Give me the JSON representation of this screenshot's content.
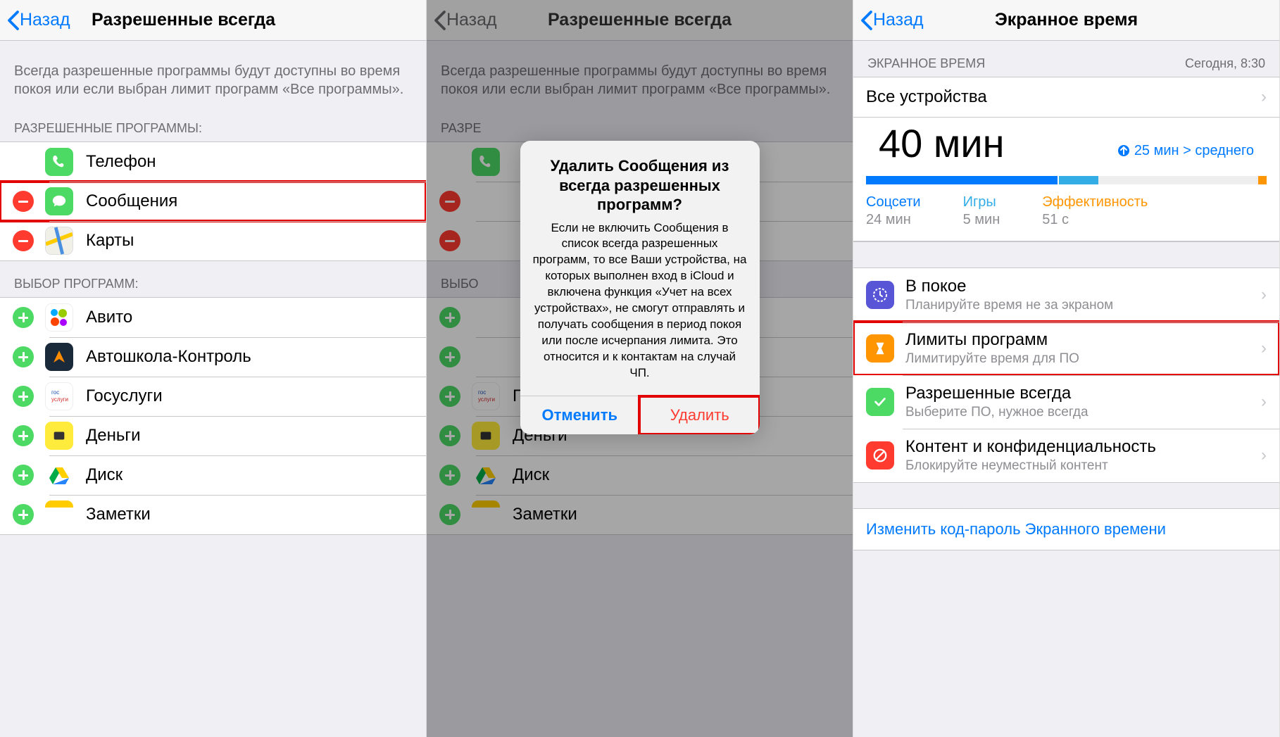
{
  "panel1": {
    "back": "Назад",
    "title": "Разрешенные всегда",
    "desc": "Всегда разрешенные программы будут доступны во время покоя или если выбран лимит программ «Все программы».",
    "sectionAllowed": "РАЗРЕШЕННЫЕ ПРОГРАММЫ:",
    "sectionChoose": "ВЫБОР ПРОГРАММ:",
    "allowed": [
      "Телефон",
      "Сообщения",
      "Карты"
    ],
    "choose": [
      "Авито",
      "Автошкола-Контроль",
      "Госуслуги",
      "Деньги",
      "Диск",
      "Заметки"
    ]
  },
  "panel2": {
    "back": "Назад",
    "title": "Разрешенные всегда",
    "desc": "Всегда разрешенные программы будут доступны во время покоя или если выбран лимит программ «Все программы».",
    "sectionAllowed": "РАЗРЕ",
    "sectionChoose": "ВЫБО",
    "allowed_row1": "",
    "choose": [
      "",
      "",
      "Госуслуги",
      "Деньги",
      "Диск",
      "Заметки"
    ],
    "dialog": {
      "title": "Удалить Сообщения из всегда разрешенных программ?",
      "body": "Если не включить Сообщения в список всегда разрешенных программ, то все Ваши устройства, на которых выполнен вход в iCloud и включена функция «Учет на всех устройствах», не смогут отправлять и получать сообщения в период покоя или после исчерпания лимита. Это относится и к контактам на случай ЧП.",
      "cancel": "Отменить",
      "delete": "Удалить"
    }
  },
  "panel3": {
    "back": "Назад",
    "title": "Экранное время",
    "sectionTime": "ЭКРАННОЕ ВРЕМЯ",
    "sectionTimeRight": "Сегодня, 8:30",
    "devices": "Все устройства",
    "bigTime": "40 мин",
    "trend": "25 мин > среднего",
    "stats": {
      "social": {
        "label": "Соцсети",
        "value": "24 мин"
      },
      "games": {
        "label": "Игры",
        "value": "5 мин"
      },
      "prod": {
        "label": "Эффективность",
        "value": "51 с"
      }
    },
    "menu": {
      "dnd": {
        "title": "В покое",
        "sub": "Планируйте время не за экраном"
      },
      "limits": {
        "title": "Лимиты программ",
        "sub": "Лимитируйте время для ПО"
      },
      "allowed": {
        "title": "Разрешенные всегда",
        "sub": "Выберите ПО, нужное всегда"
      },
      "content": {
        "title": "Контент и конфиденциальность",
        "sub": "Блокируйте неуместный контент"
      }
    },
    "changeCode": "Изменить код-пароль Экранного времени"
  }
}
